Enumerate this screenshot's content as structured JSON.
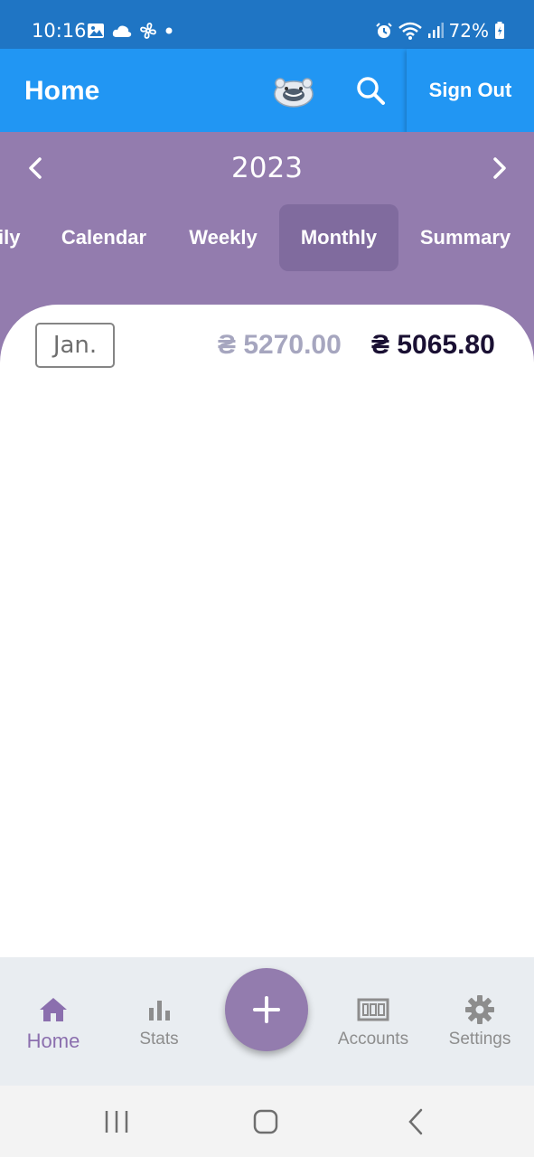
{
  "status_bar": {
    "time": "10:16",
    "battery": "72%"
  },
  "app_bar": {
    "title": "Home",
    "sign_out_label": "Sign Out"
  },
  "year_nav": {
    "year": "2023"
  },
  "tabs": [
    {
      "label": "ily",
      "active": false
    },
    {
      "label": "Calendar",
      "active": false
    },
    {
      "label": "Weekly",
      "active": false
    },
    {
      "label": "Monthly",
      "active": true
    },
    {
      "label": "Summary",
      "active": false
    }
  ],
  "month_row": {
    "month": "Jan.",
    "income": "₴ 5270.00",
    "expense": "₴ 5065.80"
  },
  "bottom_nav": {
    "items": [
      {
        "label": "Home",
        "icon": "home-icon",
        "active": true
      },
      {
        "label": "Stats",
        "icon": "bar-chart-icon",
        "active": false
      },
      {
        "label": "Accounts",
        "icon": "accounts-icon",
        "active": false
      },
      {
        "label": "Settings",
        "icon": "gear-icon",
        "active": false
      }
    ],
    "fab_icon": "plus-icon"
  },
  "colors": {
    "app_bar": "#2196f3",
    "status_bar": "#1f75c4",
    "header_purple": "#937cae",
    "active_tab": "#806b9e",
    "accent": "#8b6fae",
    "income": "#a6a6bf",
    "expense": "#1a1033"
  }
}
